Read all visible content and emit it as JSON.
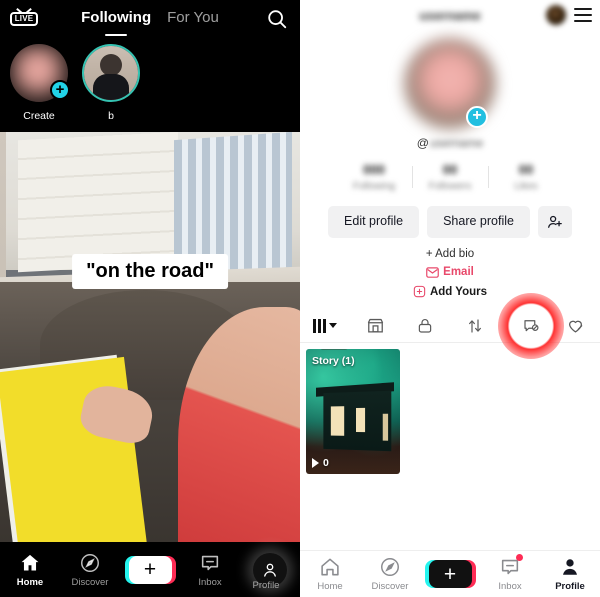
{
  "left_panel": {
    "topbar": {
      "live_label": "LIVE",
      "tabs": [
        {
          "label": "Following",
          "active": true
        },
        {
          "label": "For You",
          "active": false
        }
      ],
      "search_icon": "search-icon"
    },
    "stories": [
      {
        "label": "Create",
        "badge": "+",
        "type": "create"
      },
      {
        "label": "b",
        "type": "friend-story",
        "ring_color": "#35c3b2"
      }
    ],
    "video": {
      "caption": "\"on the road\""
    },
    "bottom_nav": [
      {
        "label": "Home",
        "icon": "home-icon",
        "active": true
      },
      {
        "label": "Discover",
        "icon": "compass-icon",
        "active": false
      },
      {
        "label": "",
        "icon": "plus-create-icon",
        "active": false
      },
      {
        "label": "Inbox",
        "icon": "inbox-icon",
        "active": false
      },
      {
        "label": "Profile",
        "icon": "person-icon",
        "active": false
      }
    ]
  },
  "right_panel": {
    "topbar": {
      "username": "username",
      "avatar": "avatar",
      "menu_icon": "hamburger-menu-icon"
    },
    "profile": {
      "avatar_badge": "+",
      "handle_prefix": "@",
      "handle": "username",
      "stats": [
        {
          "value": "000",
          "label": "Following"
        },
        {
          "value": "00",
          "label": "Followers"
        },
        {
          "value": "00",
          "label": "Likes"
        }
      ],
      "actions": {
        "edit_profile": "Edit profile",
        "share_profile": "Share profile",
        "add_friends_icon": "add-person-icon"
      },
      "bio": {
        "add_bio": "+ Add bio",
        "email": "Email",
        "email_icon": "envelope-icon",
        "add_yours": "Add Yours",
        "add_yours_icon": "add-yours-icon"
      }
    },
    "tabs": [
      {
        "icon": "grid-icon",
        "name": "posts-tab",
        "active": true,
        "has_chevron": true
      },
      {
        "icon": "shop-icon",
        "name": "shop-tab",
        "active": false
      },
      {
        "icon": "lock-icon",
        "name": "private-tab",
        "active": false
      },
      {
        "icon": "repost-icon",
        "name": "reposts-tab",
        "active": false
      },
      {
        "icon": "story-icon",
        "name": "story-tab",
        "active": false,
        "highlighted": true
      },
      {
        "icon": "heart-slash-icon",
        "name": "liked-tab",
        "active": false
      }
    ],
    "content": {
      "story_card": {
        "tag": "Story (1)",
        "play_count": "0",
        "play_icon": "play-icon"
      }
    },
    "bottom_nav": [
      {
        "label": "Home",
        "icon": "home-icon",
        "active": false
      },
      {
        "label": "Discover",
        "icon": "compass-icon",
        "active": false
      },
      {
        "label": "",
        "icon": "plus-create-icon",
        "active": false
      },
      {
        "label": "Inbox",
        "icon": "inbox-icon",
        "active": false,
        "badge": true
      },
      {
        "label": "Profile",
        "icon": "person-icon",
        "active": true
      }
    ]
  },
  "colors": {
    "accent_cyan": "#25f4ee",
    "accent_pink": "#fe2c55",
    "highlight_red": "#ff2828",
    "story_ring": "#35c3b2",
    "email_red": "#e8486a"
  }
}
